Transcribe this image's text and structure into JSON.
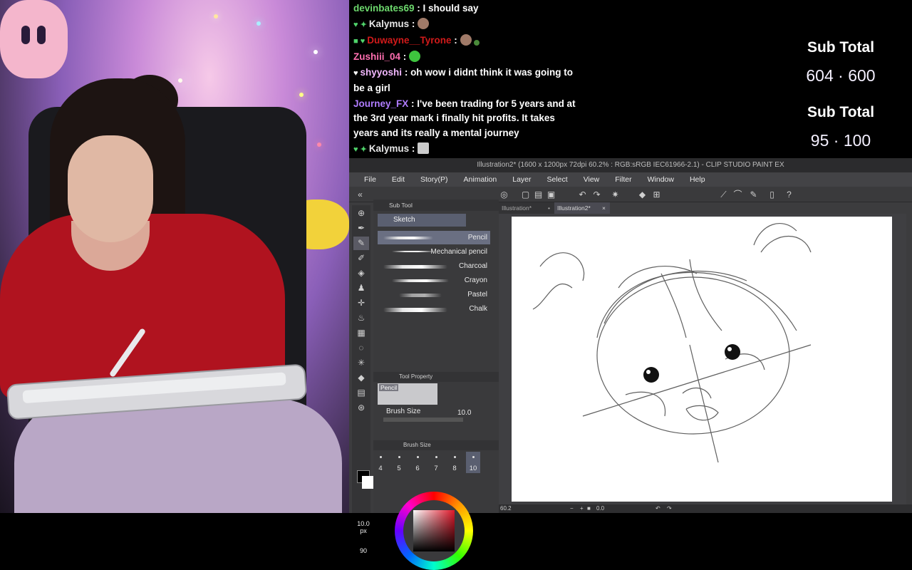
{
  "chat": {
    "messages": [
      {
        "user": "devinbates69",
        "user_color": "#6dd96d",
        "text": "I should say",
        "badges": ""
      },
      {
        "user": "Kalymus",
        "user_color": "#e6e6e6",
        "text": "",
        "badges": "♥ ✦"
      },
      {
        "user": "Duwayne__Tyrone",
        "user_color": "#d11a1a",
        "text": "",
        "badges": "■ ♥"
      },
      {
        "user": "Zushiii_04",
        "user_color": "#ff6fb0",
        "text": "",
        "badges": ""
      },
      {
        "user": "shyyoshi",
        "user_color": "#f2b8ff",
        "text": "oh wow i didnt think it was going to be a girl",
        "badges": "♥"
      },
      {
        "user": "Journey_FX",
        "user_color": "#b07cff",
        "text": "I've been trading for 5 years and at the 3rd year mark i finally hit profits. It takes years and its really a mental journey",
        "badges": ""
      },
      {
        "user": "Kalymus",
        "user_color": "#e6e6e6",
        "text": "",
        "badges": "♥ ✦"
      }
    ]
  },
  "subs": {
    "label_1": "Sub Total",
    "value_1": "604 · 600",
    "label_2": "Sub Total",
    "value_2": "95 · 100"
  },
  "csp": {
    "title": "Illustration2* (1600 x 1200px 72dpi 60.2% : RGB:sRGB IEC61966-2.1) - CLIP STUDIO PAINT EX",
    "menu": [
      "File",
      "Edit",
      "Story(P)",
      "Animation",
      "Layer",
      "Select",
      "View",
      "Filter",
      "Window",
      "Help"
    ],
    "tabs": [
      "Illustration*",
      "Illustration2*"
    ],
    "sub_tool_header": "Sub Tool",
    "sub_tool_group": "Sketch",
    "brushes": [
      "Pencil",
      "Mechanical pencil",
      "Charcoal",
      "Crayon",
      "Pastel",
      "Chalk"
    ],
    "selected_brush": "Pencil",
    "tool_property_header": "Tool Property",
    "tool_property_name": "Pencil",
    "brush_size_label": "Brush Size",
    "brush_size_value": "10.0",
    "brush_size_header": "Brush Size",
    "brush_size_presets": [
      "4",
      "5",
      "6",
      "7",
      "8",
      "10"
    ],
    "selected_preset": "10",
    "zoom_readout": "10.0\npx",
    "angle_readout": "90",
    "status_zoom": "60.2",
    "status_angle": "0.0",
    "colors": {
      "fg": "#000000",
      "bg": "#ffffff",
      "accent": "#5a5f70"
    }
  }
}
